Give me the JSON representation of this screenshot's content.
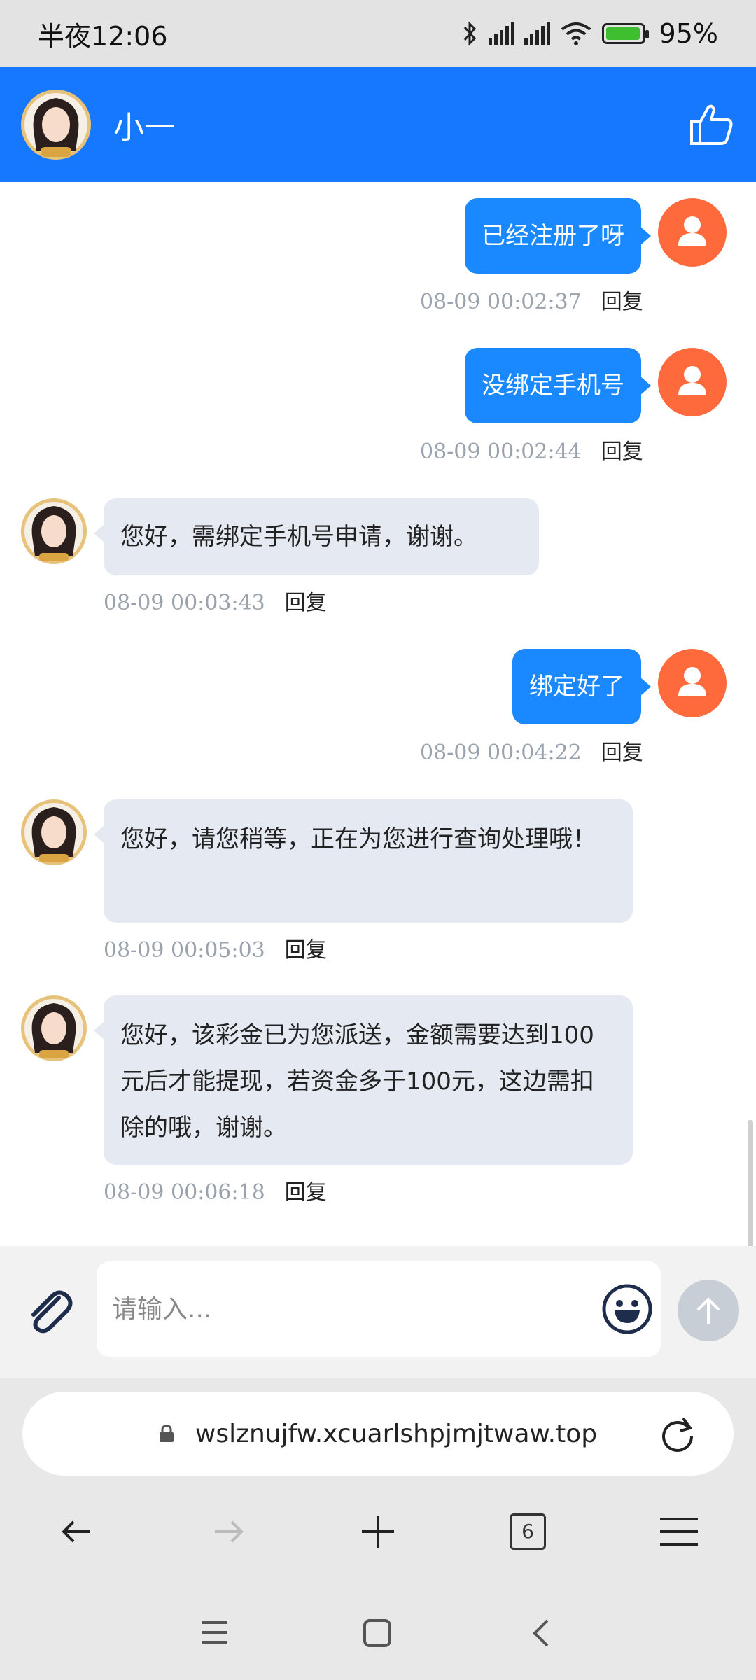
{
  "status_bar": {
    "time": "半夜12:06",
    "battery": "95%"
  },
  "header": {
    "title": "小一"
  },
  "messages": [
    {
      "side": "right",
      "text": "已经注册了呀",
      "time": "08-09 00:02:37",
      "reply": "回复"
    },
    {
      "side": "right",
      "text": "没绑定手机号",
      "time": "08-09 00:02:44",
      "reply": "回复"
    },
    {
      "side": "left",
      "text": "您好，需绑定手机号申请，谢谢。",
      "time": "08-09 00:03:43",
      "reply": "回复"
    },
    {
      "side": "right",
      "text": "绑定好了",
      "time": "08-09 00:04:22",
      "reply": "回复"
    },
    {
      "side": "left",
      "text": "您好，请您稍等，正在为您进行查询处理哦！",
      "time": "08-09 00:05:03",
      "reply": "回复"
    },
    {
      "side": "left",
      "text": "您好，该彩金已为您派送，金额需要达到100元后才能提现，若资金多于100元，这边需扣除的哦，谢谢。",
      "time": "08-09 00:06:18",
      "reply": "回复"
    }
  ],
  "input": {
    "placeholder": "请输入..."
  },
  "browser": {
    "url": "wslznujfw.xcuarlshpjmjtwaw.top",
    "tab_count": "6"
  },
  "colors": {
    "header": "#1677ff",
    "user_bubble": "#1a89ff",
    "agent_bubble": "#e4e9f2",
    "user_avatar": "#ff6a3d"
  }
}
